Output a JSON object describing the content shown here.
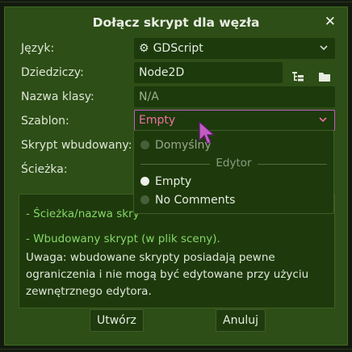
{
  "dialog": {
    "title": "Dołącz skrypt dla węzła",
    "close_label": "✕"
  },
  "form": {
    "language": {
      "label": "Język:",
      "value": "GDScript"
    },
    "inherits": {
      "label": "Dziedziczy:",
      "value": "Node2D"
    },
    "class_name": {
      "label": "Nazwa klasy:",
      "placeholder": "N/A"
    },
    "template": {
      "label": "Szablon:",
      "value": "Empty"
    },
    "built_in": {
      "label": "Skrypt wbudowany:"
    },
    "path": {
      "label": "Ścieżka:"
    }
  },
  "dropdown": {
    "default_option": "Domyślny",
    "section_label": "Edytor",
    "options": [
      {
        "label": "Empty",
        "checked": true
      },
      {
        "label": "No Comments",
        "checked": false
      }
    ]
  },
  "info": {
    "line1": "- Ścieżka/nazwa skry",
    "line2": "- Wbudowany skrypt (w plik sceny).",
    "note": "Uwaga: wbudowane skrypty posiadają pewne ograniczenia i nie mogą być edytowane przy użyciu zewnętrznego edytora."
  },
  "buttons": {
    "create": "Utwórz",
    "cancel": "Anuluj"
  },
  "colors": {
    "dialog_bg": "#2d4e16",
    "field_bg": "#1c3a0c",
    "accent": "#c15cc2",
    "info_green": "#86d66a"
  },
  "icons": {
    "language": "gear-icon",
    "inherits_tree": "tree-icon",
    "inherits_folder": "folder-icon",
    "dropdown": "chevron-down-icon",
    "cursor": "mouse-cursor-icon"
  }
}
